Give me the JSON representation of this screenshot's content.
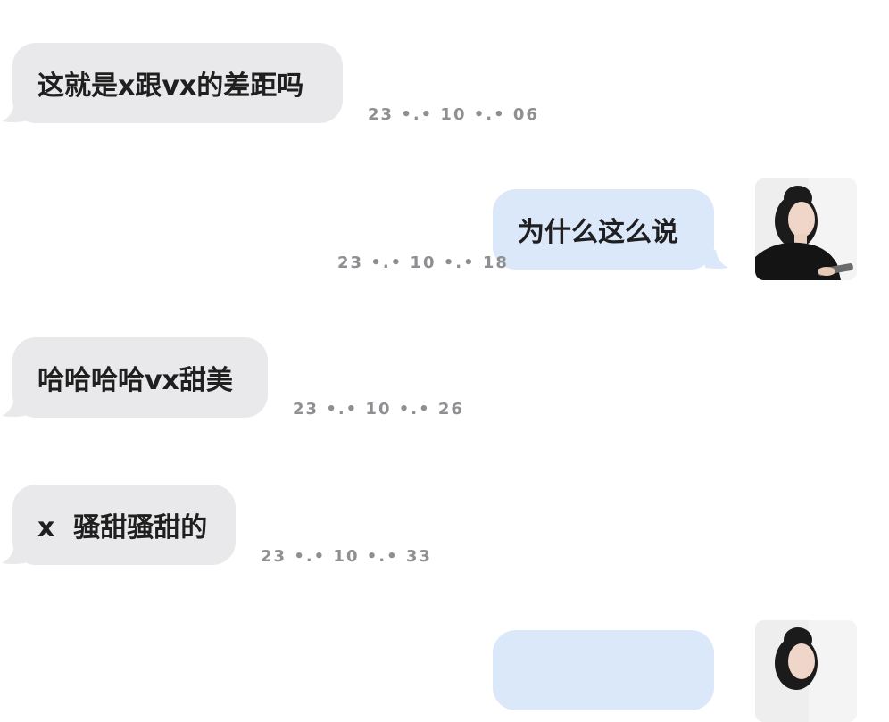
{
  "messages": [
    {
      "direction": "incoming",
      "text": "这就是x跟vx的差距吗",
      "time": "23 •.• 10 •.• 06"
    },
    {
      "direction": "outgoing",
      "text": "为什么这么说",
      "time": "23 •.• 10 •.• 18"
    },
    {
      "direction": "incoming",
      "text": "哈哈哈哈vx甜美",
      "time": "23 •.• 10 •.• 26"
    },
    {
      "direction": "incoming",
      "text": "x  骚甜骚甜的",
      "time": "23 •.• 10 •.• 33"
    },
    {
      "direction": "outgoing",
      "text": "",
      "time": ""
    }
  ],
  "colors": {
    "incoming_bubble": "#e9e9eb",
    "outgoing_bubble": "#dbe8fa",
    "timestamp": "#8e8e93",
    "text": "#1f1f1f"
  },
  "icons": {
    "avatar": "user-avatar-photo"
  }
}
